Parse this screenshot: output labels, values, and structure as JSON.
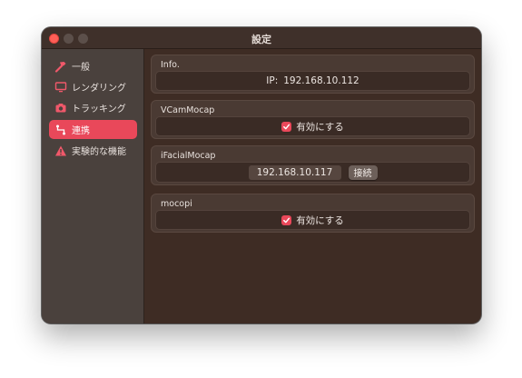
{
  "window": {
    "title": "設定"
  },
  "sidebar": {
    "items": [
      {
        "label": "一般",
        "icon": "hammer-icon",
        "active": false
      },
      {
        "label": "レンダリング",
        "icon": "monitor-icon",
        "active": false
      },
      {
        "label": "トラッキング",
        "icon": "camera-icon",
        "active": false
      },
      {
        "label": "連携",
        "icon": "connection-icon",
        "active": true
      },
      {
        "label": "実験的な機能",
        "icon": "warning-icon",
        "active": false
      }
    ]
  },
  "info": {
    "title": "Info.",
    "ip_label": "IP:",
    "ip_value": "192.168.10.112"
  },
  "vcam": {
    "title": "VCamMocap",
    "enable_label": "有効にする",
    "enabled": true
  },
  "ifacial": {
    "title": "iFacialMocap",
    "ip_value": "192.168.10.117",
    "connect_label": "接続"
  },
  "mocopi": {
    "title": "mocopi",
    "enable_label": "有効にする",
    "enabled": true
  },
  "colors": {
    "accent": "#e9485a",
    "window_bg": "#3e2c24",
    "sidebar_bg": "#4a413d",
    "close_button": "#fe5f57"
  }
}
